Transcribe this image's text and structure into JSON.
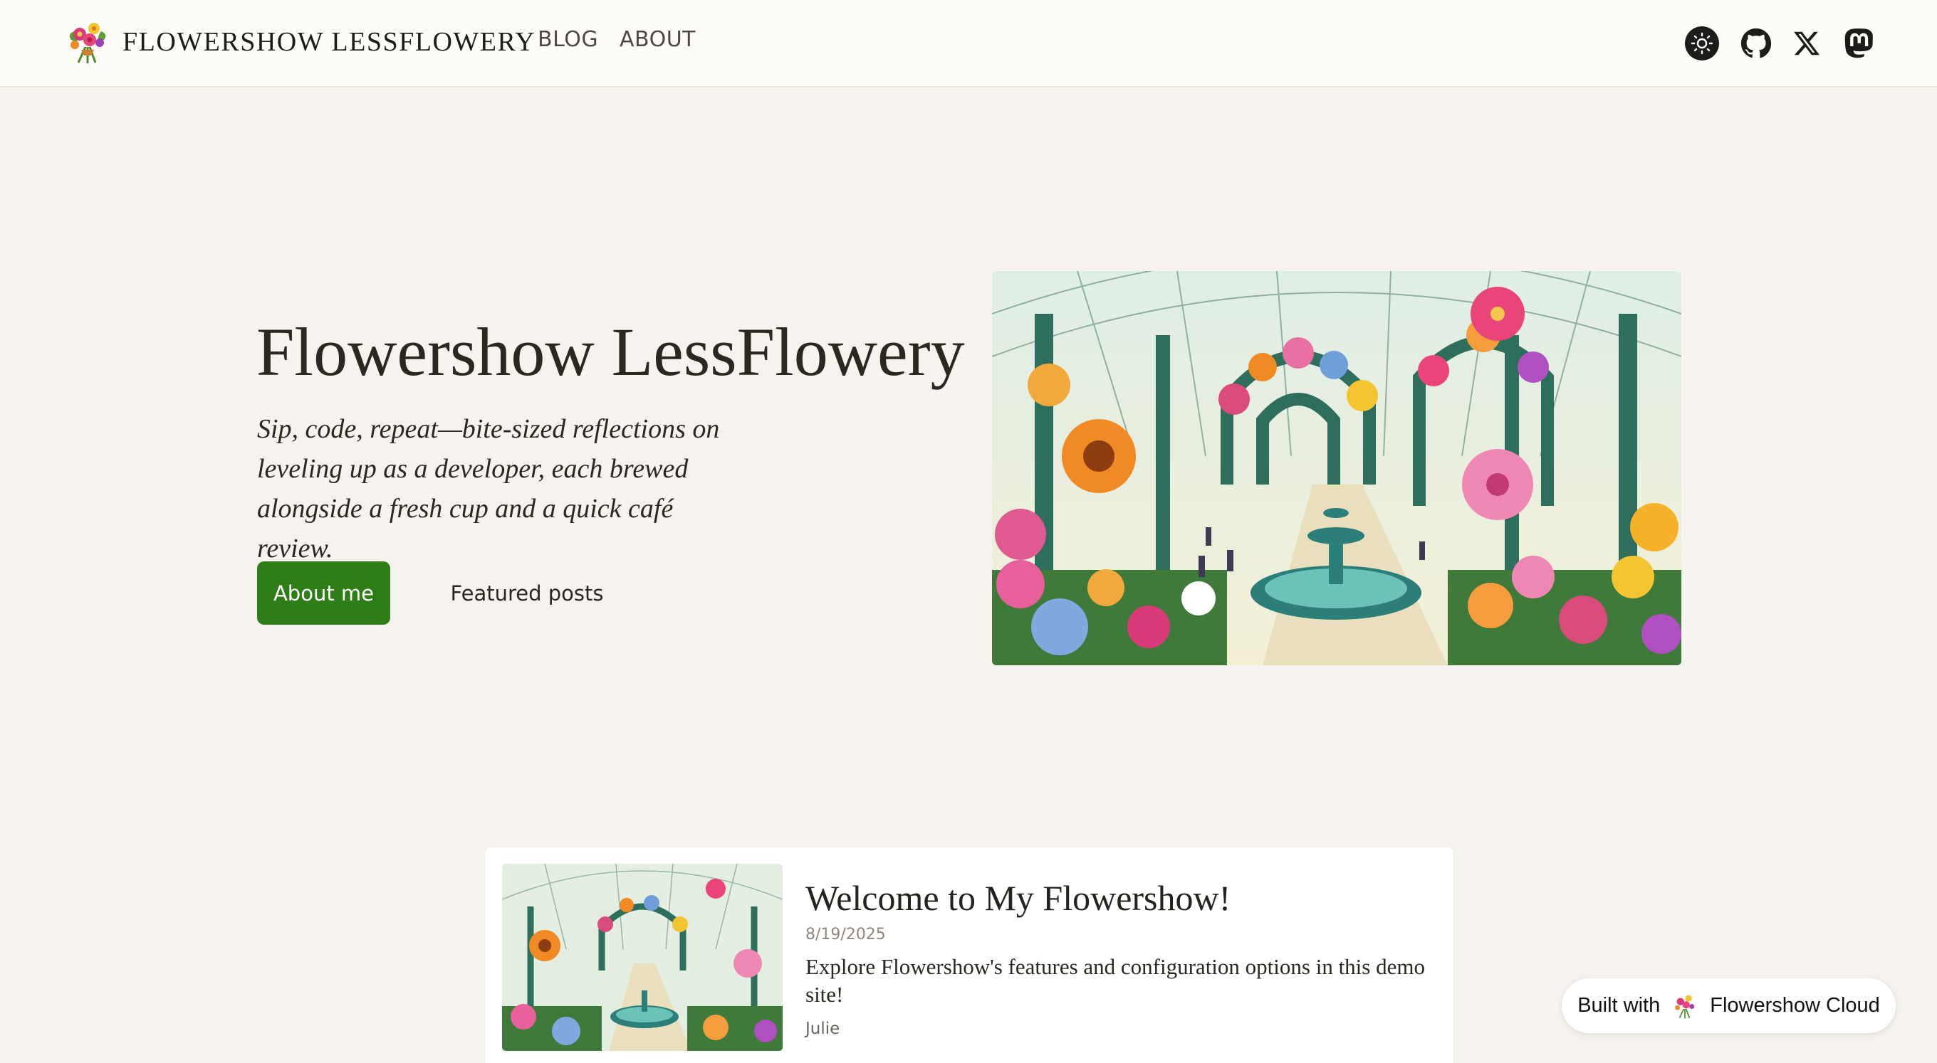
{
  "header": {
    "site_name": "FLOWERSHOW LESSFLOWERY",
    "nav": [
      {
        "label": "BLOG"
      },
      {
        "label": "ABOUT"
      }
    ],
    "icons": [
      "sun-icon",
      "github-icon",
      "x-icon",
      "mastodon-icon"
    ]
  },
  "hero": {
    "title": "Flowershow LessFlowery",
    "subtitle": "Sip, code, repeat—bite-sized reflections on leveling up as a developer, each brewed alongside a fresh cup and a quick café review.",
    "primary_button": "About me",
    "secondary_button": "Featured posts"
  },
  "post": {
    "title": "Welcome to My Flowershow!",
    "date": "8/19/2025",
    "description": "Explore Flowershow's features and configuration options in this demo site!",
    "author": "Julie"
  },
  "badge": {
    "prefix": "Built with",
    "name": "Flowershow Cloud"
  },
  "colors": {
    "accent_green": "#2f7d16",
    "page_background": "#f6f3ee",
    "header_background": "#fdfcf9"
  }
}
